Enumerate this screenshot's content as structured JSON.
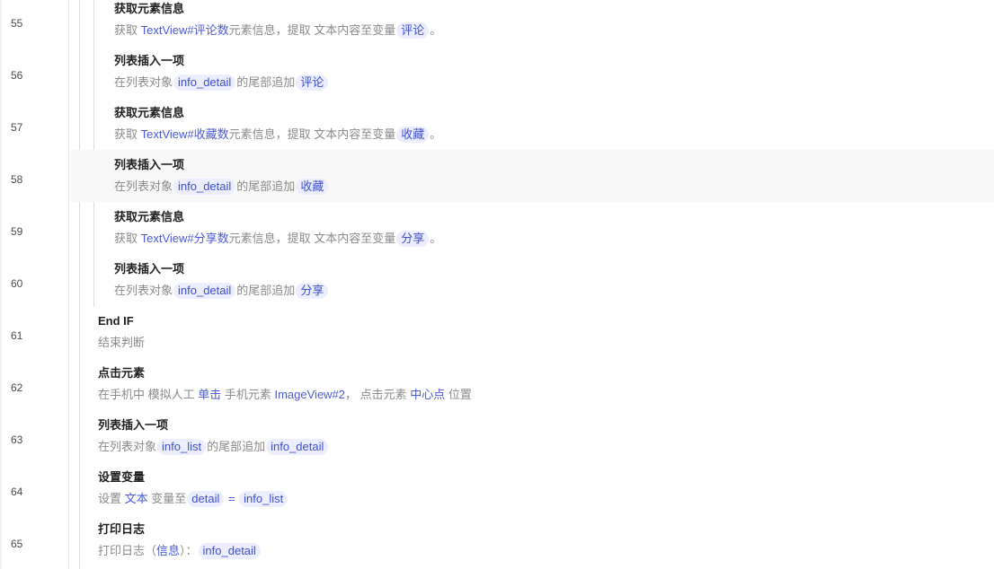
{
  "line_numbers": [
    "55",
    "56",
    "57",
    "58",
    "59",
    "60",
    "61",
    "62",
    "63",
    "64",
    "65"
  ],
  "steps": {
    "s55": {
      "title": "获取元素信息",
      "p1": "获取 ",
      "el": "TextView#评论数",
      "p2": "元素信息，提取 文本内容至变量",
      "var": "评论",
      "p3": "。"
    },
    "s56": {
      "title": "列表插入一项",
      "p1": "在列表对象",
      "obj": "info_detail",
      "p2": "的尾部追加",
      "val": "评论"
    },
    "s57": {
      "title": "获取元素信息",
      "p1": "获取 ",
      "el": "TextView#收藏数",
      "p2": "元素信息，提取 文本内容至变量",
      "var": "收藏",
      "p3": "。"
    },
    "s58": {
      "title": "列表插入一项",
      "p1": "在列表对象",
      "obj": "info_detail",
      "p2": "的尾部追加",
      "val": "收藏"
    },
    "s59": {
      "title": "获取元素信息",
      "p1": "获取 ",
      "el": "TextView#分享数",
      "p2": "元素信息，提取 文本内容至变量",
      "var": "分享",
      "p3": "。"
    },
    "s60": {
      "title": "列表插入一项",
      "p1": "在列表对象",
      "obj": "info_detail",
      "p2": "的尾部追加",
      "val": "分享"
    },
    "s61": {
      "title": "End IF",
      "desc": "结束判断"
    },
    "s62": {
      "title": "点击元素",
      "p1": "在手机中 模拟人工 ",
      "action": "单击",
      "p2": " 手机元素 ",
      "el": "ImageView#2",
      "p3": "， 点击元素 ",
      "pos": "中心点",
      "p4": " 位置"
    },
    "s63": {
      "title": "列表插入一项",
      "p1": "在列表对象",
      "obj": "info_list",
      "p2": "的尾部追加",
      "val": "info_detail"
    },
    "s64": {
      "title": "设置变量",
      "p1": "设置 ",
      "type": "文本",
      "p2": " 变量至",
      "var": "detail",
      "eq": " = ",
      "val": "info_list"
    },
    "s65": {
      "title": "打印日志",
      "p1": "打印日志（",
      "level": "信息",
      "p2": "）：",
      "val": "info_detail"
    }
  },
  "colors": {
    "link": "#4a5ad6",
    "pill_bg": "#eceefd",
    "pill_text": "#3c4fd0",
    "title": "#1f1f1f",
    "desc": "#8a8a8a",
    "highlight_row": "#f8f8f9"
  }
}
